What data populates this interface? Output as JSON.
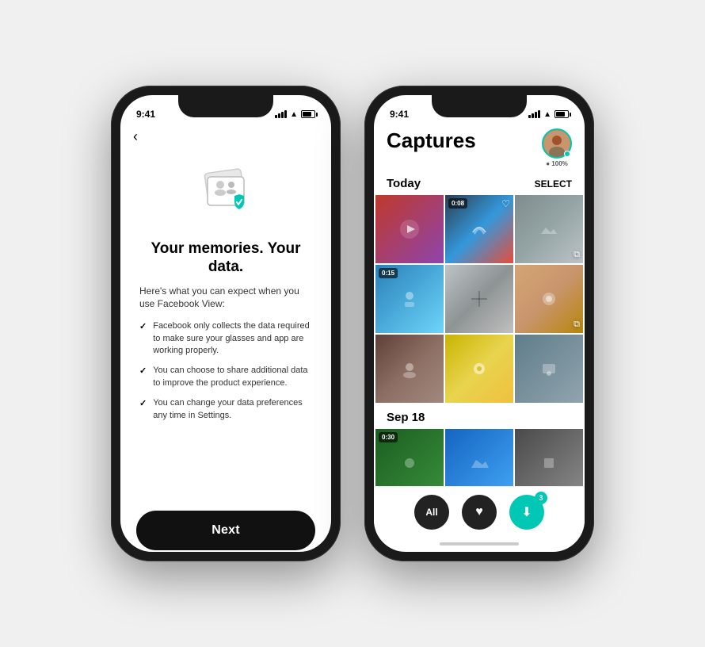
{
  "left_phone": {
    "status_time": "9:41",
    "back_label": "‹",
    "title": "Your memories. Your data.",
    "subtitle": "Here's what you can expect when you use Facebook View:",
    "bullets": [
      "Facebook only collects the data required to make sure your glasses and app are working properly.",
      "You can choose to share additional data to improve the product experience.",
      "You can change your data preferences any time in Settings."
    ],
    "next_button_label": "Next"
  },
  "right_phone": {
    "status_time": "9:41",
    "captures_title": "Captures",
    "avatar_pct": "● 100%",
    "today_label": "Today",
    "select_label": "SELECT",
    "sep18_label": "Sep 18",
    "tab_all": "All",
    "tab_heart": "♥",
    "tab_download": "⬇",
    "tab_badge": "3",
    "photos": [
      {
        "id": 1,
        "type": "photo",
        "cls": "p1"
      },
      {
        "id": 2,
        "type": "video",
        "badge": "0:08",
        "cls": "p2",
        "heart": true
      },
      {
        "id": 3,
        "type": "photo",
        "cls": "p3",
        "copy": true
      },
      {
        "id": 4,
        "type": "video",
        "badge": "0:15",
        "cls": "p4"
      },
      {
        "id": 5,
        "type": "photo",
        "cls": "p5"
      },
      {
        "id": 6,
        "type": "photo",
        "cls": "p6",
        "copy": true
      },
      {
        "id": 7,
        "type": "photo",
        "cls": "p7"
      },
      {
        "id": 8,
        "type": "photo",
        "cls": "p8"
      },
      {
        "id": 9,
        "type": "photo",
        "cls": "p9"
      },
      {
        "id": 10,
        "type": "video",
        "badge": "0:30",
        "cls": "p10"
      },
      {
        "id": 11,
        "type": "photo",
        "cls": "p11"
      },
      {
        "id": 12,
        "type": "photo",
        "cls": "p12"
      },
      {
        "id": 13,
        "type": "photo",
        "cls": "p13"
      },
      {
        "id": 14,
        "type": "photo",
        "cls": "p14"
      }
    ]
  }
}
